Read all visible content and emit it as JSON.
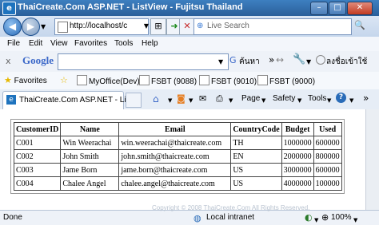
{
  "window": {
    "title": "ThaiCreate.Com ASP.NET - ListView - Fujitsu Thailand",
    "app_icon": "ie-icon"
  },
  "address_bar": {
    "url": "http://localhost/c",
    "search_placeholder": "Live Search"
  },
  "menu": {
    "items": [
      "File",
      "Edit",
      "View",
      "Favorites",
      "Tools",
      "Help"
    ]
  },
  "google_toolbar": {
    "close_label": "x",
    "brand": "Google",
    "search_label": "ค้นหา",
    "signin_label": "ลงชื่อเข้าใช้"
  },
  "favorites_bar": {
    "favorites_label": "Favorites",
    "items": [
      "MyOffice(Dev)",
      "FSBT (9088)",
      "FSBT (9010)",
      "FSBT (9000)"
    ]
  },
  "tab": {
    "label": "ThaiCreate.Com ASP.NET - Lis...",
    "page_label": "Page",
    "safety_label": "Safety",
    "tools_label": "Tools"
  },
  "grid": {
    "columns": [
      "CustomerID",
      "Name",
      "Email",
      "CountryCode",
      "Budget",
      "Used"
    ],
    "rows": [
      [
        "C001",
        "Win Weerachai",
        "win.weerachai@thaicreate.com",
        "TH",
        "1000000",
        "600000"
      ],
      [
        "C002",
        "John Smith",
        "john.smith@thaicreate.com",
        "EN",
        "2000000",
        "800000"
      ],
      [
        "C003",
        "Jame Born",
        "jame.born@thaicreate.com",
        "US",
        "3000000",
        "600000"
      ],
      [
        "C004",
        "Chalee Angel",
        "chalee.angel@thaicreate.com",
        "US",
        "4000000",
        "100000"
      ]
    ]
  },
  "status": {
    "left": "Done",
    "zone": "Local intranet",
    "zoom": "100%",
    "watermark": "Copyright © 2008 ThaiCreate.Com All Rights Reserved."
  }
}
